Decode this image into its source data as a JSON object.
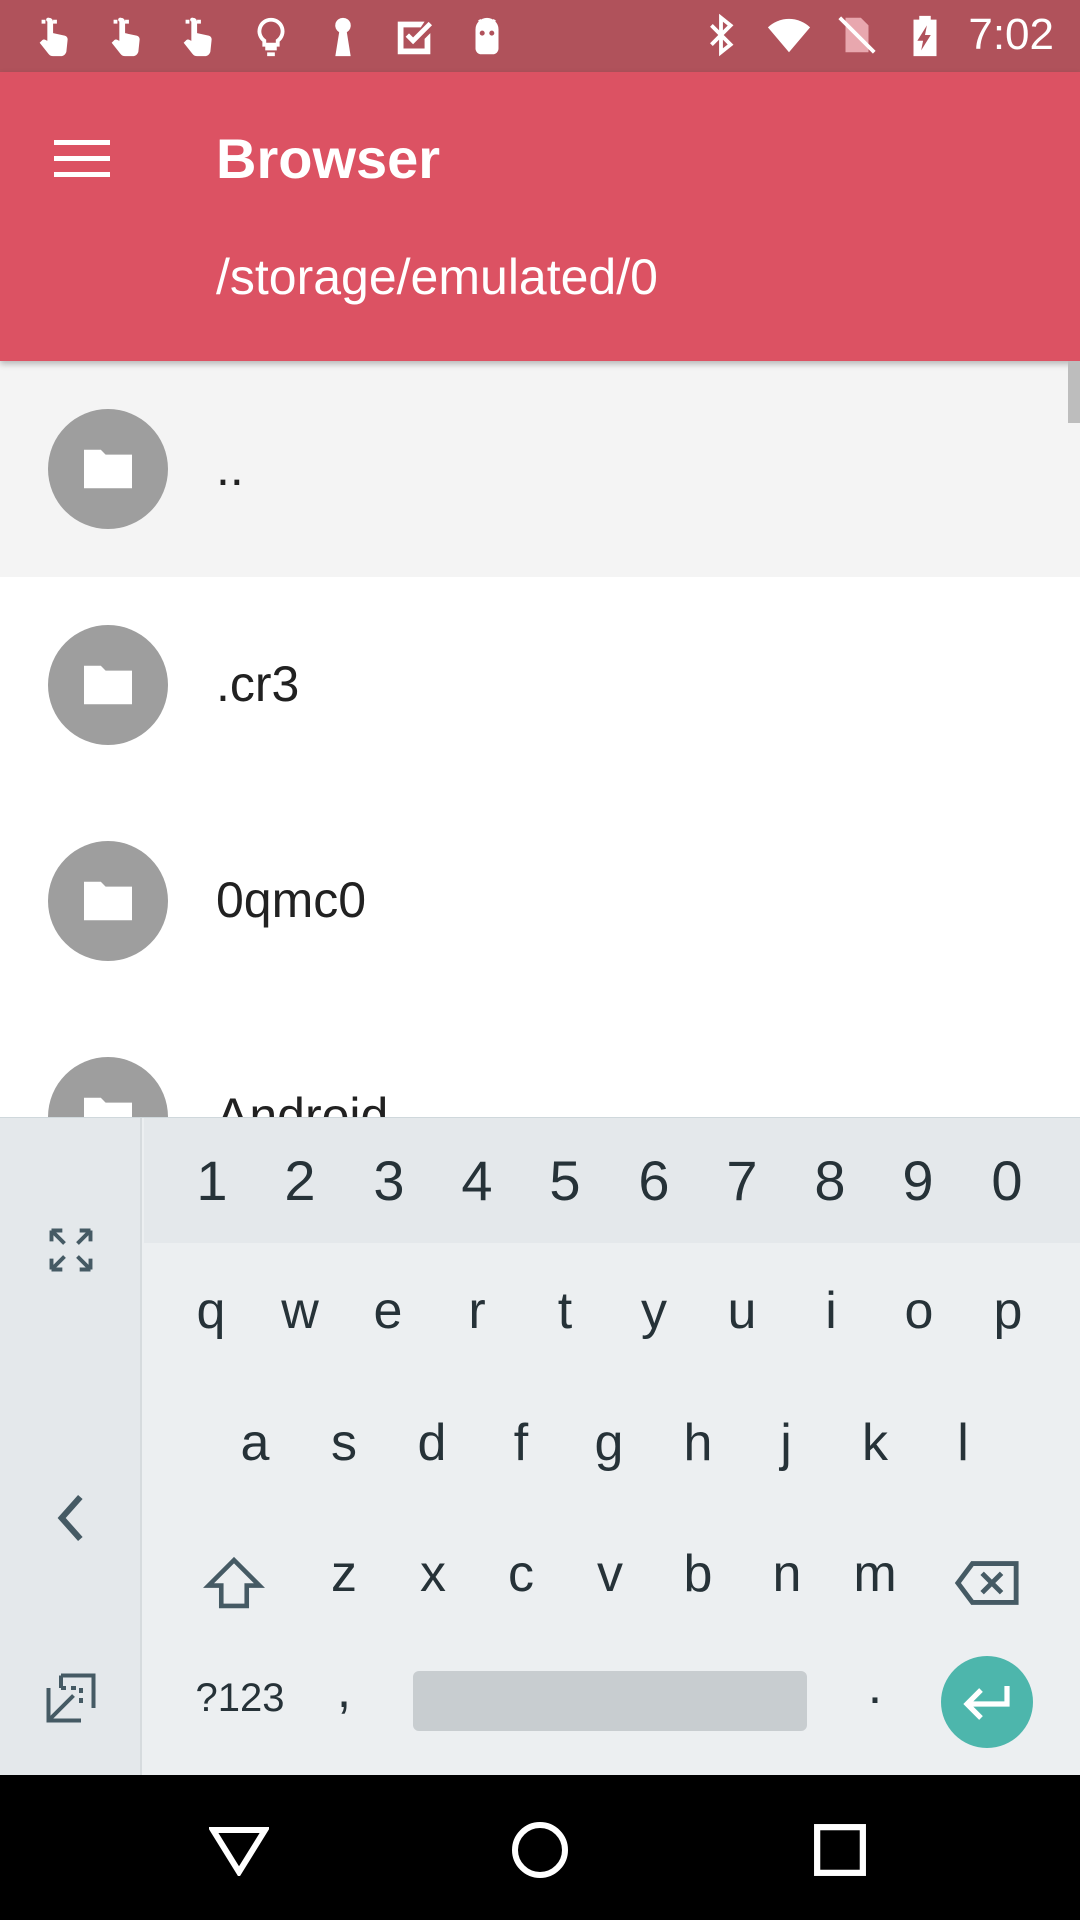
{
  "status_bar": {
    "time": "7:02",
    "background": "#b0525b",
    "left_icons": [
      "touch-icon",
      "touch-icon",
      "touch-icon",
      "lightbulb-icon",
      "keyhole-icon",
      "checkbox-icon",
      "android-icon"
    ],
    "right_icons": [
      "bluetooth-icon",
      "wifi-icon",
      "no-sim-icon",
      "battery-charging-icon"
    ]
  },
  "app_bar": {
    "background": "#dc5263",
    "title": "Browser",
    "subtitle": "/storage/emulated/0",
    "menu_icon": "hamburger-menu-icon"
  },
  "file_list": {
    "items": [
      {
        "name": "..",
        "icon": "folder-icon",
        "selected": true
      },
      {
        "name": ".cr3",
        "icon": "folder-icon",
        "selected": false
      },
      {
        "name": "0qmc0",
        "icon": "folder-icon",
        "selected": false
      },
      {
        "name": "Android",
        "icon": "folder-icon",
        "selected": false
      }
    ]
  },
  "keyboard": {
    "number_row": [
      "1",
      "2",
      "3",
      "4",
      "5",
      "6",
      "7",
      "8",
      "9",
      "0"
    ],
    "row1": [
      "q",
      "w",
      "e",
      "r",
      "t",
      "y",
      "u",
      "i",
      "o",
      "p"
    ],
    "row2": [
      "a",
      "s",
      "d",
      "f",
      "g",
      "h",
      "j",
      "k",
      "l"
    ],
    "row3": [
      "z",
      "x",
      "c",
      "v",
      "b",
      "n",
      "m"
    ],
    "symbols_label": "?123",
    "comma": ",",
    "period": ".",
    "enter_color": "#4db6ac",
    "side_icons": [
      "fullscreen-icon",
      "chevron-left-icon",
      "undock-icon"
    ]
  },
  "nav_bar": {
    "buttons": [
      "back-icon",
      "home-icon",
      "recents-icon"
    ]
  }
}
